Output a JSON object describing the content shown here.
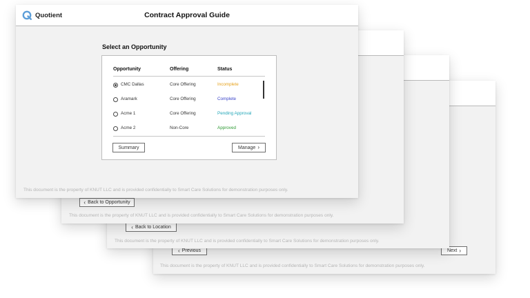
{
  "app": {
    "brand": "Quotient",
    "title": "Contract Approval Guide"
  },
  "footer_text": "This document is the property of KNUT LLC and is provided confidentially to Smart Care Solutions for demonstration purposes only.",
  "colors": {
    "incomplete": "#e6a21c",
    "complete": "#3a43c9",
    "pending_approval": "#22a6b8",
    "approved": "#2e9a33",
    "logo": "#5e9fd9"
  },
  "opportunity": {
    "heading": "Select an Opportunity",
    "columns": [
      "Opportunity",
      "Offering",
      "Status"
    ],
    "rows": [
      {
        "name": "CMC Dallas",
        "offering": "Core Offering",
        "status": "Incomplete",
        "status_key": "incomplete",
        "selected": true
      },
      {
        "name": "Aramark",
        "offering": "Core Offering",
        "status": "Complete",
        "status_key": "complete",
        "selected": false
      },
      {
        "name": "Acme 1",
        "offering": "Core Offering",
        "status": "Pending Approval",
        "status_key": "pending_approval",
        "selected": false
      },
      {
        "name": "Acme 2",
        "offering": "Non-Core",
        "status": "Approved",
        "status_key": "approved",
        "selected": false
      }
    ],
    "summary_label": "Summary",
    "manage_label": "Manage"
  },
  "back_cards": {
    "back_to_opportunity": "Back to Opportunity",
    "back_to_location": "Back to Location",
    "previous": "Previous",
    "next": "Next"
  },
  "icons": {
    "chevron_left": "‹",
    "chevron_right": "›",
    "logo": "quotient-logo-icon"
  }
}
